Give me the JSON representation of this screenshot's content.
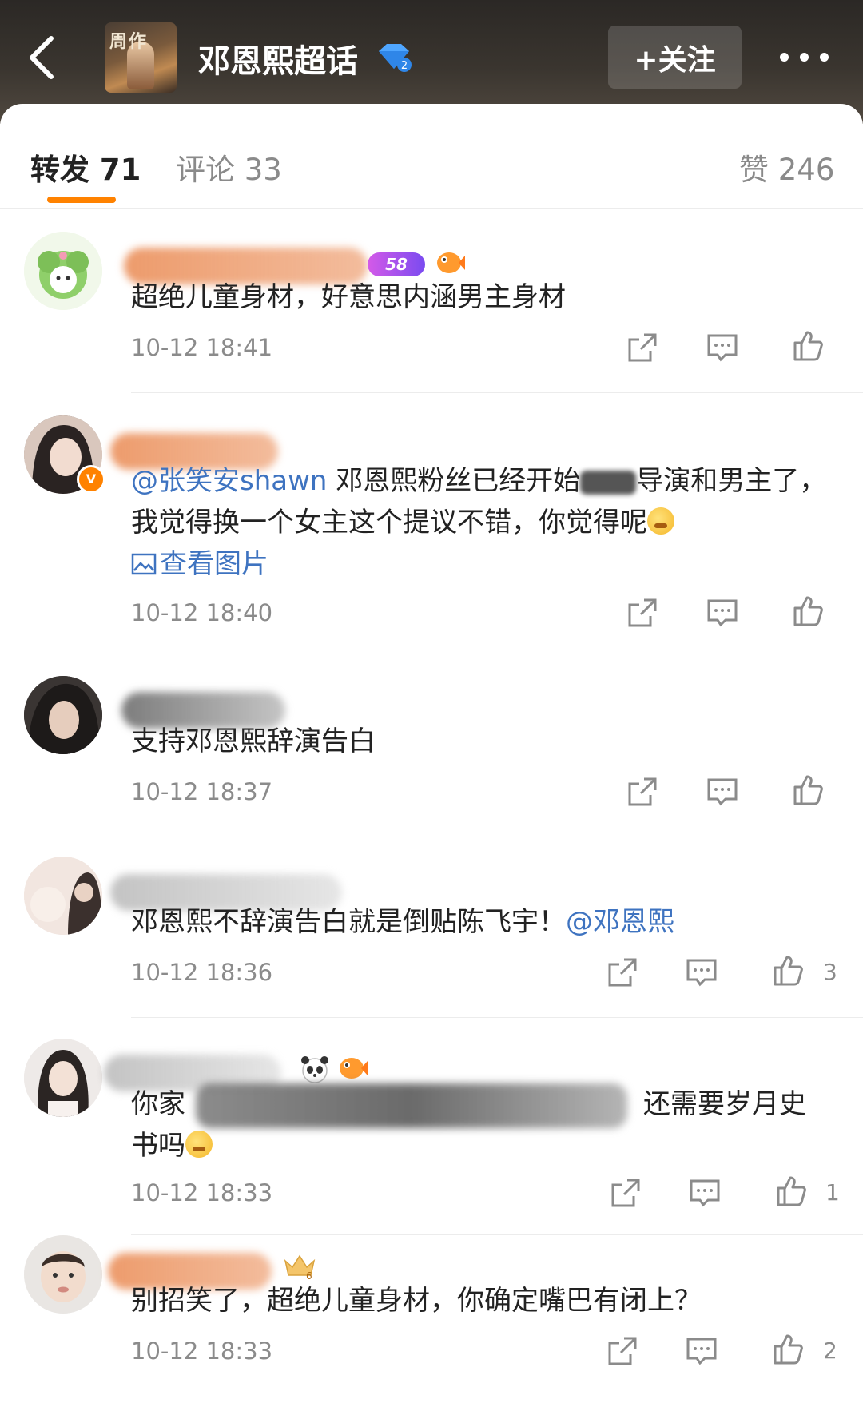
{
  "header": {
    "topic_title": "邓恩熙超话",
    "cover_text": "周作",
    "follow_label": "+关注"
  },
  "tabs": {
    "repost": "转发 71",
    "comment": "评论 33",
    "like": "赞 246"
  },
  "colors": {
    "accent": "#ff8200",
    "link": "#3e73c0",
    "muted": "#8b8b8b"
  },
  "comments": [
    {
      "text": "超绝儿童身材，好意思内涵男主身材",
      "time": "10-12 18:41",
      "badge_level": "58",
      "like_count": ""
    },
    {
      "mention": "@张笑安shawn",
      "text_before": "  邓恩熙粉丝已经开始",
      "text_after": "导演和男主了，我觉得换一个女主这个提议不错，你觉得呢",
      "link": "查看图片",
      "time": "10-12 18:40",
      "like_count": ""
    },
    {
      "text": "支持邓恩熙辞演告白",
      "time": "10-12 18:37",
      "like_count": ""
    },
    {
      "text": "邓恩熙不辞演告白就是倒贴陈飞宇！",
      "mention": "@邓恩熙",
      "time": "10-12 18:36",
      "like_count": "3"
    },
    {
      "text_start": "你家",
      "text_end": "还需要岁月史",
      "text_line2": "书吗",
      "time": "10-12 18:33",
      "like_count": "1"
    },
    {
      "text": "别招笑了，超绝儿童身材，你确定嘴巴有闭上？",
      "time": "10-12 18:33",
      "like_count": "2",
      "crown_level": "6"
    }
  ]
}
